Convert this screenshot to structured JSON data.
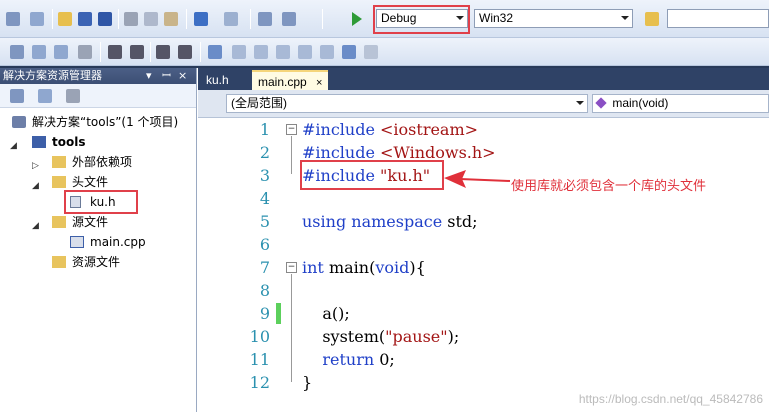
{
  "toolbar": {
    "config_selected": "Debug",
    "platform_selected": "Win32",
    "search_value": ""
  },
  "solution_explorer": {
    "title": "解决方案资源管理器",
    "pin_glyph": "▾",
    "pin2_glyph": "ꟷ",
    "close_glyph": "×",
    "tree": [
      {
        "label": "解决方案“tools”(1 个项目)",
        "icon": "solution-icon"
      },
      {
        "label": "tools",
        "icon": "project-icon"
      },
      {
        "label": "外部依赖项",
        "icon": "folder-icon"
      },
      {
        "label": "头文件",
        "icon": "folder-icon"
      },
      {
        "label": "ku.h",
        "icon": "header-file-icon"
      },
      {
        "label": "源文件",
        "icon": "folder-icon"
      },
      {
        "label": "main.cpp",
        "icon": "cpp-file-icon"
      },
      {
        "label": "资源文件",
        "icon": "folder-icon"
      }
    ]
  },
  "editor": {
    "tabs": [
      {
        "label": "ku.h",
        "active": false
      },
      {
        "label": "main.cpp",
        "active": true
      }
    ],
    "scope": "(全局范围)",
    "member": "main(void)",
    "code": {
      "line_numbers": [
        "1",
        "2",
        "3",
        "4",
        "5",
        "6",
        "7",
        "8",
        "9",
        "10",
        "11",
        "12"
      ],
      "l1_a": "#include ",
      "l1_b": "<iostream>",
      "l2_a": "#include ",
      "l2_b": "<Windows.h>",
      "l3_a": "#include ",
      "l3_b": "\"ku.h\"",
      "l5_a": "using",
      "l5_b": " ",
      "l5_c": "namespace",
      "l5_d": " std;",
      "l7_a": "int",
      "l7_b": " main(",
      "l7_c": "void",
      "l7_d": "){",
      "l9": "    a();",
      "l10_a": "    system(",
      "l10_b": "\"pause\"",
      "l10_c": ");",
      "l11_a": "    return",
      "l11_b": " 0;",
      "l12": "}"
    }
  },
  "annotation": "使用库就必须包含一个库的头文件",
  "watermark": "https://blog.csdn.net/qq_45842786",
  "colors": {
    "accent_red": "#e0404a",
    "keyword_blue": "#2040c8",
    "string_red": "#a31515",
    "line_num": "#2b91af"
  }
}
